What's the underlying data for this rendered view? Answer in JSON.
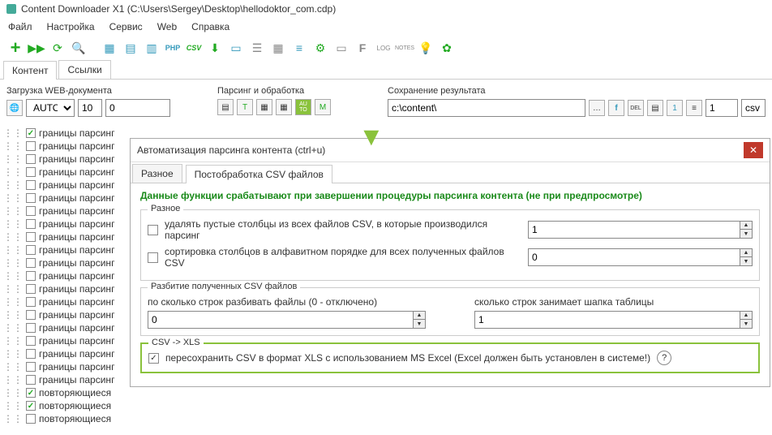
{
  "title": "Content Downloader X1 (C:\\Users\\Sergey\\Desktop\\hellodoktor_com.cdp)",
  "menu": {
    "file": "Файл",
    "settings": "Настройка",
    "service": "Сервис",
    "web": "Web",
    "help": "Справка"
  },
  "tabs": {
    "content": "Контент",
    "links": "Ссылки"
  },
  "panels": {
    "load": "Загрузка WEB-документа",
    "load_mode": "AUTO",
    "load_val1": "10",
    "load_val2": "0",
    "parse": "Парсинг и обработка",
    "save": "Сохранение результата",
    "save_path": "c:\\content\\",
    "save_spin": "1",
    "save_ext": "csv"
  },
  "tree_items": [
    {
      "checked": true,
      "label": "границы парсинг"
    },
    {
      "checked": false,
      "label": "границы парсинг"
    },
    {
      "checked": false,
      "label": "границы парсинг"
    },
    {
      "checked": false,
      "label": "границы парсинг"
    },
    {
      "checked": false,
      "label": "границы парсинг"
    },
    {
      "checked": false,
      "label": "границы парсинг"
    },
    {
      "checked": false,
      "label": "границы парсинг"
    },
    {
      "checked": false,
      "label": "границы парсинг"
    },
    {
      "checked": false,
      "label": "границы парсинг"
    },
    {
      "checked": false,
      "label": "границы парсинг"
    },
    {
      "checked": false,
      "label": "границы парсинг"
    },
    {
      "checked": false,
      "label": "границы парсинг"
    },
    {
      "checked": false,
      "label": "границы парсинг"
    },
    {
      "checked": false,
      "label": "границы парсинг"
    },
    {
      "checked": false,
      "label": "границы парсинг"
    },
    {
      "checked": false,
      "label": "границы парсинг"
    },
    {
      "checked": false,
      "label": "границы парсинг"
    },
    {
      "checked": false,
      "label": "границы парсинг"
    },
    {
      "checked": false,
      "label": "границы парсинг"
    },
    {
      "checked": false,
      "label": "границы парсинг"
    },
    {
      "checked": true,
      "label": "повторяющиеся"
    },
    {
      "checked": true,
      "label": "повторяющиеся"
    },
    {
      "checked": false,
      "label": "повторяющиеся"
    }
  ],
  "dialog": {
    "title": "Автоматизация парсинга контента (ctrl+u)",
    "tab1": "Разное",
    "tab2": "Постобработка CSV файлов",
    "notice": "Данные функции срабатывают при завершении процедуры парсинга контента (не при предпросмотре)",
    "group_misc": "Разное",
    "misc_opt1": "удалять пустые столбцы из всех файлов CSV, в которые производился парсинг",
    "misc_val1": "1",
    "misc_opt2": "сортировка столбцов в алфавитном порядке для всех полученных файлов CSV",
    "misc_val2": "0",
    "group_split": "Разбитие полученных CSV файлов",
    "split_lbl1": "по сколько строк разбивать файлы (0 - отключено)",
    "split_val1": "0",
    "split_lbl2": "сколько строк занимает шапка таблицы",
    "split_val2": "1",
    "group_xls": "CSV -> XLS",
    "xls_opt": "пересохранить CSV в формат XLS с использованием MS Excel (Excel должен быть установлен в системе!)"
  }
}
